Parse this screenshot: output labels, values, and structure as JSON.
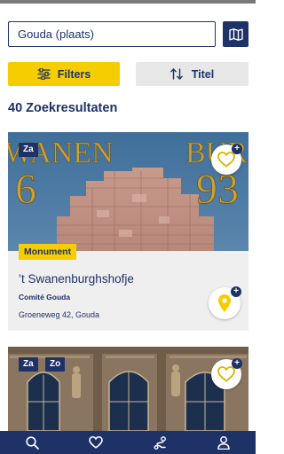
{
  "search": {
    "placeholder": "Gouda (plaats)"
  },
  "toolbar": {
    "filters_label": "Filters",
    "sort_label": "Titel"
  },
  "results": {
    "count_label": "40 Zoekresultaten"
  },
  "cards": [
    {
      "days": [
        "Za"
      ],
      "category": "Monument",
      "title": "’t Swanenburghshofje",
      "organizer": "Comité Gouda",
      "address": "Groeneweg 42, Gouda",
      "image_text": [
        "WANEN",
        "BUR",
        "6",
        "93"
      ]
    },
    {
      "days": [
        "Za",
        "Zo"
      ]
    }
  ],
  "icons": {
    "map": "map-icon",
    "filters": "sliders-icon",
    "sort": "sort-arrows-icon",
    "favorite": "heart-plus-icon",
    "pin": "map-pin-plus-icon",
    "nav": [
      "search-icon",
      "heart-icon",
      "route-icon",
      "user-icon"
    ]
  },
  "colors": {
    "brand_navy": "#1e3268",
    "accent_yellow": "#f5cd00",
    "card_bg": "#efefef"
  }
}
